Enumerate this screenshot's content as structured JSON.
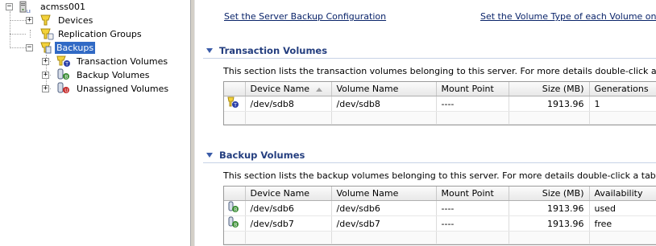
{
  "tree": {
    "root": "acmss001",
    "items": [
      {
        "label": "Devices",
        "expander": "+"
      },
      {
        "label": "Replication Groups",
        "expander": ""
      },
      {
        "label": "Backups",
        "expander": "−",
        "selected": true
      },
      {
        "label": "Transaction Volumes",
        "expander": "+"
      },
      {
        "label": "Backup Volumes",
        "expander": "+"
      },
      {
        "label": "Unassigned Volumes",
        "expander": "+"
      }
    ],
    "root_expander": "−"
  },
  "links": {
    "backup_config": "Set the Server Backup Configuration",
    "volume_type": "Set the Volume Type of each Volume on this S"
  },
  "transaction": {
    "title": "Transaction Volumes",
    "description": "This section lists the transaction volumes belonging to this server. For more details double-click a table row.",
    "columns": [
      "Device Name",
      "Volume Name",
      "Mount Point",
      "Size (MB)",
      "Generations"
    ],
    "rows": [
      {
        "device": "/dev/sdb8",
        "volume": "/dev/sdb8",
        "mount": "----",
        "size": "1913.96",
        "extra": "1"
      }
    ]
  },
  "backup": {
    "title": "Backup Volumes",
    "description": "This section lists the backup volumes belonging to this server. For more details double-click a table row.",
    "columns": [
      "Device Name",
      "Volume Name",
      "Mount Point",
      "Size (MB)",
      "Availability"
    ],
    "rows": [
      {
        "device": "/dev/sdb6",
        "volume": "/dev/sdb6",
        "mount": "----",
        "size": "1913.96",
        "extra": "used"
      },
      {
        "device": "/dev/sdb7",
        "volume": "/dev/sdb7",
        "mount": "----",
        "size": "1913.96",
        "extra": "free"
      }
    ]
  },
  "colors": {
    "selection": "#316ac5",
    "section_title": "#243e7f",
    "link": "#0a246a"
  }
}
